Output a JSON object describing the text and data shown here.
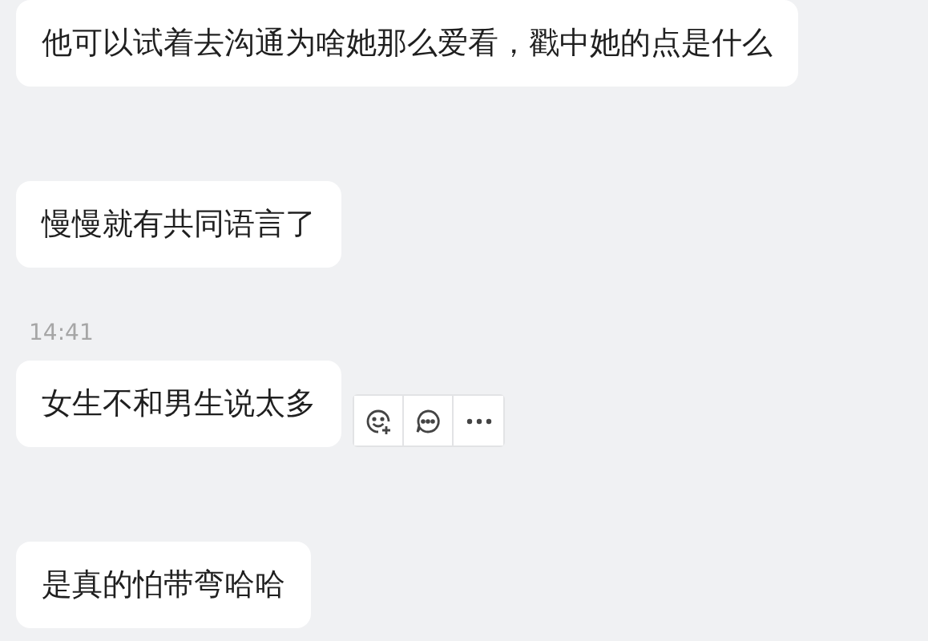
{
  "messages": [
    {
      "kind": "text",
      "text": "他可以试着去沟通为啥她那么爱看，戳中她的点是什么",
      "actions": false
    },
    {
      "kind": "text",
      "text": "慢慢就有共同语言了",
      "actions": false
    },
    {
      "kind": "time",
      "text": "14:41"
    },
    {
      "kind": "text",
      "text": "女生不和男生说太多",
      "actions": true
    },
    {
      "kind": "text",
      "text": "是真的怕带弯哈哈",
      "actions": false
    }
  ]
}
